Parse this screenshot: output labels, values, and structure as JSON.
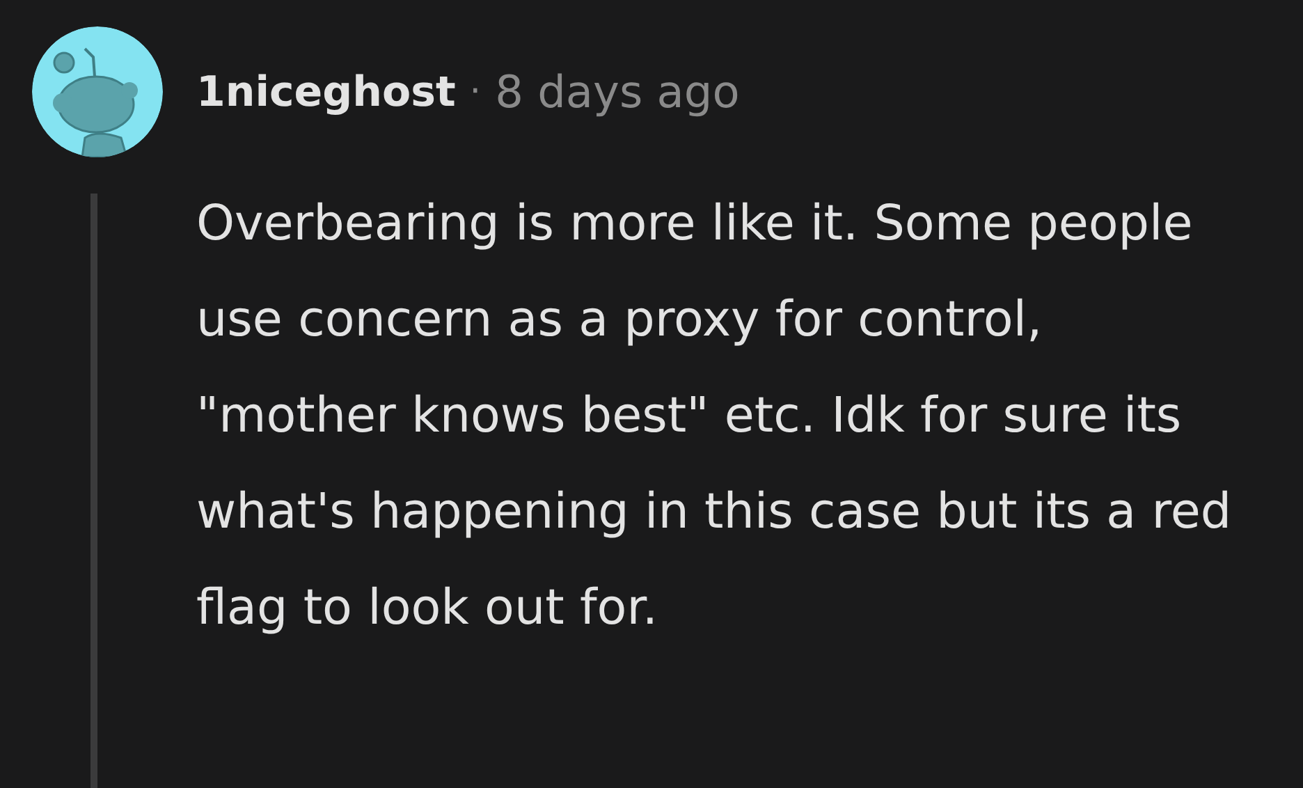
{
  "comment": {
    "author": "1niceghost",
    "separator": "·",
    "time": "8 days ago",
    "body": "Overbearing is more like it. Some people use concern as a proxy for control, \"mother knows best\" etc. Idk for sure its what's happening in this case but its a red flag to look out for."
  }
}
